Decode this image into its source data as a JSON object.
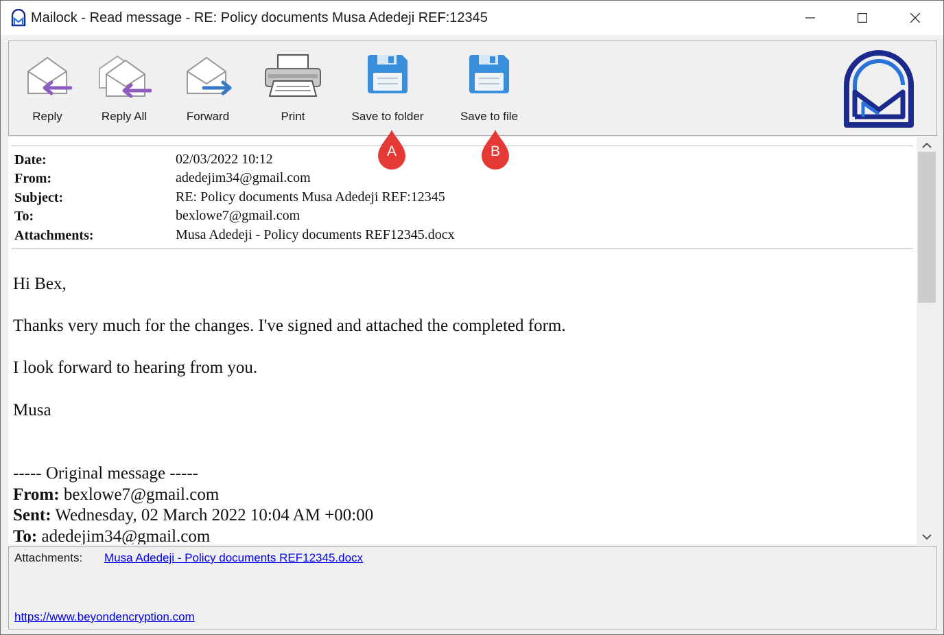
{
  "window": {
    "title": "Mailock - Read message - RE: Policy documents Musa Adedeji REF:12345"
  },
  "toolbar": {
    "reply_label": "Reply",
    "reply_all_label": "Reply All",
    "forward_label": "Forward",
    "print_label": "Print",
    "save_to_folder_label": "Save to folder",
    "save_to_file_label": "Save to file"
  },
  "callouts": {
    "a": "A",
    "b": "B"
  },
  "header": {
    "date_label": "Date:",
    "date": "02/03/2022 10:12",
    "from_label": "From:",
    "from": "adedejim34@gmail.com",
    "subject_label": "Subject:",
    "subject": "RE: Policy documents Musa Adedeji REF:12345",
    "to_label": "To:",
    "to": "bexlowe7@gmail.com",
    "attachments_label": "Attachments:",
    "attachments": "Musa Adedeji - Policy documents REF12345.docx"
  },
  "body": {
    "greeting": "Hi Bex,",
    "line1": "Thanks very much for the changes. I've signed and attached the completed form.",
    "line2": "I look forward to hearing from you.",
    "signoff": "Musa"
  },
  "original": {
    "separator": "----- Original message -----",
    "from_label": "From:",
    "from": "bexlowe7@gmail.com",
    "sent_label": "Sent:",
    "sent": "Wednesday, 02 March 2022 10:04 AM +00:00",
    "to_label": "To:",
    "to": "adedejim34@gmail.com"
  },
  "attachments_bar": {
    "label": "Attachments:",
    "file": "Musa Adedeji - Policy documents REF12345.docx",
    "website": "https://www.beyondencryption.com"
  },
  "colors": {
    "accent_blue": "#3a8fdc",
    "logo_navy": "#1b2a8c",
    "logo_blue": "#2a73d9",
    "callout_red": "#e53935",
    "link_blue": "#0000ee"
  },
  "icons": [
    "mailock-app-icon",
    "minimize-icon",
    "maximize-icon",
    "close-icon",
    "reply-icon",
    "reply-all-icon",
    "forward-icon",
    "printer-icon",
    "floppy-disk-icon",
    "mailock-logo",
    "chevron-up-icon",
    "chevron-down-icon"
  ]
}
